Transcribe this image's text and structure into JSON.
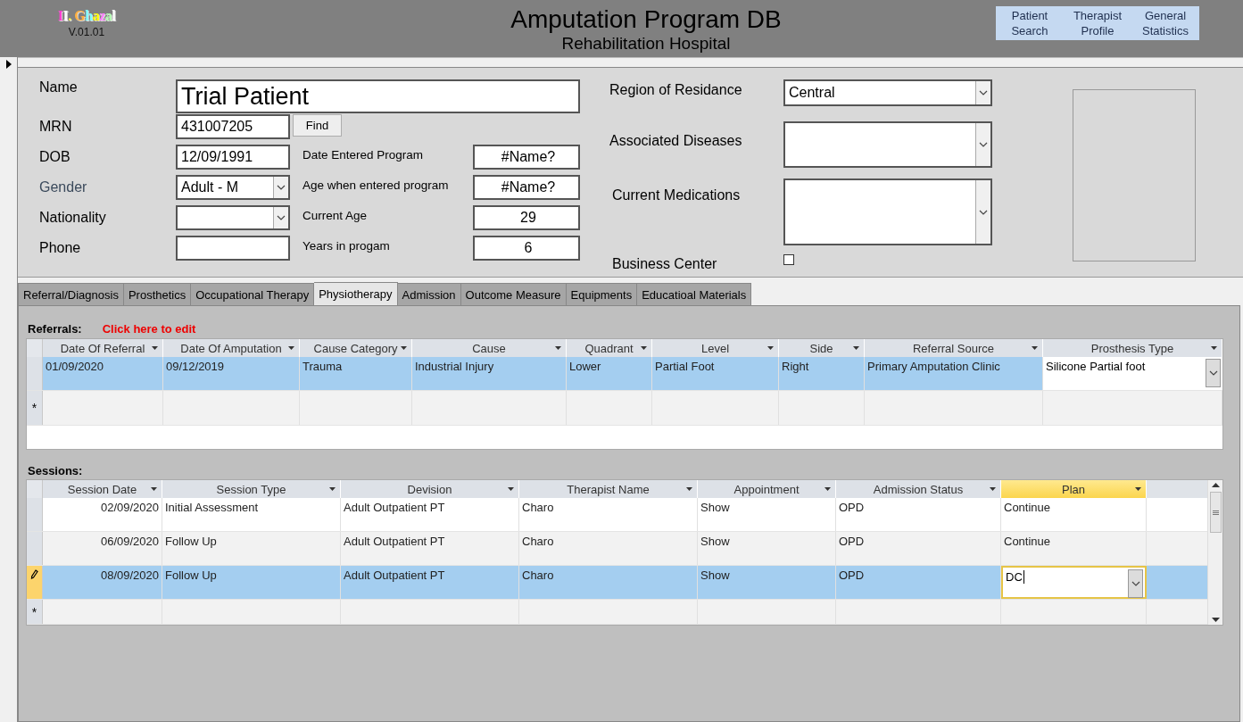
{
  "header": {
    "logo": "II. Ghazal",
    "version": "V.01.01",
    "title": "Amputation Program DB",
    "subtitle": "Rehabilitation Hospital",
    "nav_buttons": [
      [
        "Patient",
        "Search"
      ],
      [
        "Therapist",
        "Profile"
      ],
      [
        "General",
        "Statistics"
      ]
    ]
  },
  "patient": {
    "name": {
      "label": "Name",
      "value": "Trial Patient"
    },
    "mrn": {
      "label": "MRN",
      "value": "431007205",
      "button": "Find"
    },
    "dob": {
      "label": "DOB",
      "value": "12/09/1991"
    },
    "gender": {
      "label": "Gender",
      "value": "Adult - M",
      "kind": "combo"
    },
    "nationality": {
      "label": "Nationality",
      "kind": "combo"
    },
    "phone": {
      "label": "Phone"
    },
    "date_entered": {
      "label": "Date Entered Program",
      "value": "#Name?"
    },
    "age_entered": {
      "label": "Age when entered program",
      "value": "#Name?"
    },
    "current_age": {
      "label": "Current Age",
      "value": "29"
    },
    "years": {
      "label": "Years in progam",
      "value": "6"
    },
    "region": {
      "label": "Region of Residance",
      "value": "Central",
      "kind": "combo"
    },
    "diseases": {
      "label": "Associated Diseases",
      "kind": "combo"
    },
    "medications": {
      "label": "Current Medications",
      "kind": "combo"
    },
    "business_center": {
      "label": "Business Center",
      "checked": false
    }
  },
  "tabs": [
    {
      "label": "Referral/Diagnosis",
      "selected": false
    },
    {
      "label": "Prosthetics",
      "selected": false
    },
    {
      "label": "Occupational Therapy",
      "selected": false
    },
    {
      "label": "Physiotherapy",
      "selected": true
    },
    {
      "label": "Admission",
      "selected": false
    },
    {
      "label": "Outcome Measure",
      "selected": false
    },
    {
      "label": "Equipments",
      "selected": false
    },
    {
      "label": "Educatioal Materials",
      "selected": false
    }
  ],
  "referrals": {
    "label": "Referrals:",
    "edit_link": "Click here to edit",
    "focused": false,
    "new_row_marker": "*",
    "columns": [
      {
        "label": "Date Of Referral",
        "active": false
      },
      {
        "label": "Date Of Amputation",
        "active": false
      },
      {
        "label": "Cause Category",
        "active": false
      },
      {
        "label": "Cause",
        "active": false
      },
      {
        "label": "Quadrant",
        "active": false
      },
      {
        "label": "Level",
        "active": false
      },
      {
        "label": "Side",
        "active": false
      },
      {
        "label": "Referral Source",
        "active": false
      },
      {
        "label": "Prosthesis Type",
        "active": true
      }
    ],
    "rows": [
      {
        "selected": true,
        "editing": false,
        "cells": [
          "01/09/2020",
          "09/12/2019",
          "Trauma",
          "Industrial Injury",
          "Lower",
          "Partial Foot",
          "Right",
          "Primary Amputation Clinic",
          "Silicone Partial foot"
        ]
      }
    ]
  },
  "sessions": {
    "label": "Sessions:",
    "focused": true,
    "new_row_marker": "*",
    "columns": [
      {
        "label": "Session Date",
        "active": false
      },
      {
        "label": "Session Type",
        "active": false
      },
      {
        "label": "Devision",
        "active": false
      },
      {
        "label": "Therapist Name",
        "active": false
      },
      {
        "label": "Appointment",
        "active": false
      },
      {
        "label": "Admission Status",
        "active": false
      },
      {
        "label": "Plan",
        "active": true
      }
    ],
    "rows": [
      {
        "selected": false,
        "editing": false,
        "cells": [
          "02/09/2020",
          "Initial Assessment",
          "Adult Outpatient PT",
          "Charo",
          "Show",
          "OPD",
          "Continue"
        ]
      },
      {
        "selected": false,
        "editing": false,
        "cells": [
          "06/09/2020",
          "Follow Up",
          "Adult Outpatient PT",
          "Charo",
          "Show",
          "OPD",
          "Continue"
        ]
      },
      {
        "selected": true,
        "editing": true,
        "cells": [
          "08/09/2020",
          "Follow Up",
          "Adult Outpatient PT",
          "Charo",
          "Show",
          "OPD",
          "DC"
        ]
      }
    ]
  }
}
